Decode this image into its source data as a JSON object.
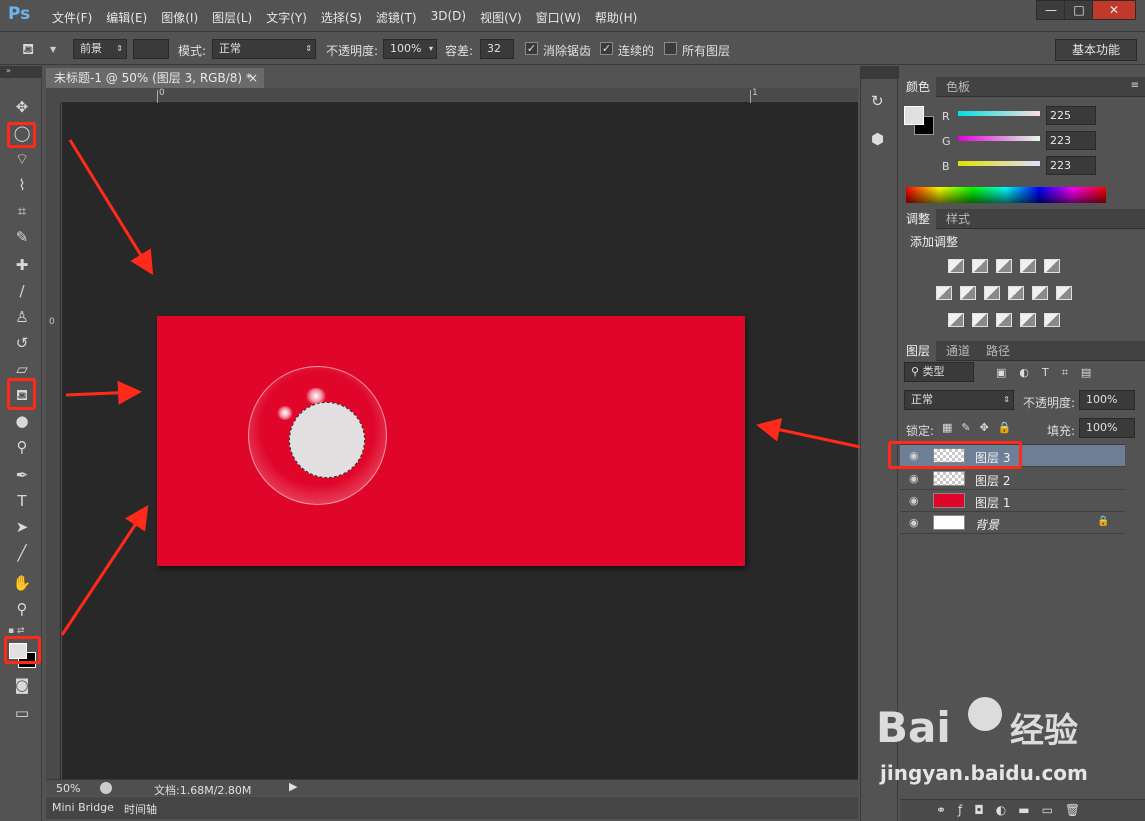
{
  "app": {
    "logo": "Ps"
  },
  "menu": [
    "文件(F)",
    "编辑(E)",
    "图像(I)",
    "图层(L)",
    "文字(Y)",
    "选择(S)",
    "滤镜(T)",
    "3D(D)",
    "视图(V)",
    "窗口(W)",
    "帮助(H)"
  ],
  "window_controls": {
    "minimize": "—",
    "maximize": "□",
    "close": "✕"
  },
  "options": {
    "fill_source": "前景",
    "mode_label": "模式:",
    "mode_value": "正常",
    "opacity_label": "不透明度:",
    "opacity_value": "100%",
    "tolerance_label": "容差:",
    "tolerance_value": "32",
    "antialias_label": "消除锯齿",
    "antialias_checked": true,
    "contiguous_label": "连续的",
    "contiguous_checked": true,
    "all_layers_label": "所有图层",
    "all_layers_checked": false,
    "workspace": "基本功能"
  },
  "document": {
    "tab_title": "未标题-1 @ 50% (图层 3, RGB/8) *",
    "close_symbol": "×",
    "ruler_h_labels": [
      "0",
      "1"
    ],
    "ruler_v_labels": [
      "0"
    ],
    "canvas_color": "#e0062a",
    "selection_fill": "#e1dfdf"
  },
  "status": {
    "zoom": "50%",
    "doc_info": "文档:1.68M/2.80M"
  },
  "bottom_tabs": [
    "Mini Bridge",
    "时间轴"
  ],
  "color_panel": {
    "tabs": [
      "颜色",
      "色板"
    ],
    "channels": [
      {
        "name": "R",
        "value": "225"
      },
      {
        "name": "G",
        "value": "223"
      },
      {
        "name": "B",
        "value": "223"
      }
    ],
    "foreground": "#e1dfdf",
    "background": "#000000"
  },
  "adjust_panel": {
    "tabs": [
      "调整",
      "样式"
    ],
    "title": "添加调整"
  },
  "layers_panel": {
    "tabs": [
      "图层",
      "通道",
      "路径"
    ],
    "filter_label": "类型",
    "blend_mode": "正常",
    "opacity_label": "不透明度:",
    "opacity_value": "100%",
    "lock_label": "锁定:",
    "fill_label": "填充:",
    "fill_value": "100%",
    "layers": [
      {
        "name": "图层 3",
        "thumb": "transparent",
        "selected": true
      },
      {
        "name": "图层 2",
        "thumb": "transparent",
        "selected": false
      },
      {
        "name": "图层 1",
        "thumb": "#e0062a",
        "selected": false
      },
      {
        "name": "背景",
        "thumb": "#ffffff",
        "selected": false,
        "locked": true
      }
    ]
  },
  "watermark": {
    "brand": "Bai",
    "brand2": "经验",
    "url": "jingyan.baidu.com"
  },
  "icons": {
    "move": "move-icon",
    "marquee": "elliptical-marquee-icon",
    "lasso": "polygonal-lasso-icon",
    "quick_select": "quick-select-icon",
    "crop": "crop-icon",
    "eyedropper": "eyedropper-icon",
    "healing": "spot-healing-icon",
    "brush": "brush-icon",
    "stamp": "clone-stamp-icon",
    "history_brush": "history-brush-icon",
    "eraser": "eraser-icon",
    "bucket": "paint-bucket-icon",
    "blur": "blur-icon",
    "dodge": "dodge-icon",
    "pen": "pen-icon",
    "type": "type-icon",
    "path_select": "path-selection-icon",
    "line": "line-icon",
    "hand": "hand-icon",
    "zoom": "zoom-icon"
  }
}
